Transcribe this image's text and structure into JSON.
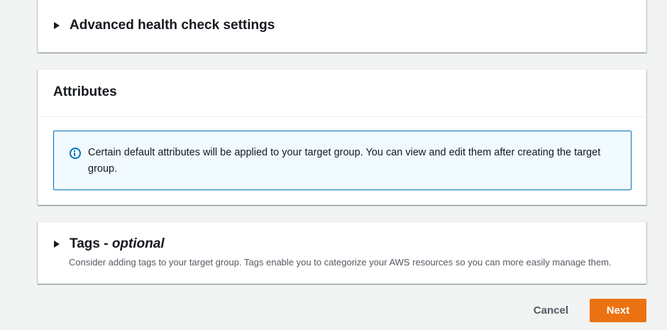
{
  "advanced_health_check": {
    "title": "Advanced health check settings",
    "icon": "caret-right-icon"
  },
  "attributes": {
    "title": "Attributes",
    "alert": {
      "icon": "info-icon",
      "text": "Certain default attributes will be applied to your target group. You can view and edit them after creating the target group."
    }
  },
  "tags": {
    "title": "Tags - ",
    "title_optional": "optional",
    "description": "Consider adding tags to your target group. Tags enable you to categorize your AWS resources so you can more easily manage them.",
    "icon": "caret-right-icon"
  },
  "footer": {
    "cancel_label": "Cancel",
    "next_label": "Next"
  },
  "colors": {
    "primary_button": "#ec7211",
    "info_border": "#0073bb",
    "info_background": "#f1faff",
    "page_background": "#f2f3f3"
  }
}
